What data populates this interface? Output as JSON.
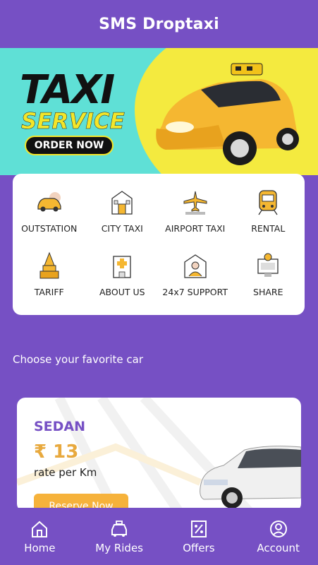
{
  "header": {
    "title": "SMS Droptaxi"
  },
  "banner": {
    "headline": "TAXI",
    "subheadline": "SERVICE",
    "cta_label": "ORDER NOW"
  },
  "services": [
    {
      "label": "OUTSTATION",
      "icon": "car-icon"
    },
    {
      "label": "CITY TAXI",
      "icon": "building-icon"
    },
    {
      "label": "AIRPORT TAXI",
      "icon": "airplane-icon"
    },
    {
      "label": "RENTAL",
      "icon": "train-icon"
    },
    {
      "label": "TARIFF",
      "icon": "temple-icon"
    },
    {
      "label": "ABOUT US",
      "icon": "hospital-icon"
    },
    {
      "label": "24x7 SUPPORT",
      "icon": "support-agent-icon"
    },
    {
      "label": "SHARE",
      "icon": "share-screen-icon"
    }
  ],
  "section": {
    "choose_title": "Choose your favorite car"
  },
  "car_card": {
    "category": "SEDAN",
    "price": "₹ 13",
    "price_unit": "rate per Km",
    "reserve_label": "Reserve Now"
  },
  "bottom_nav": [
    {
      "label": "Home",
      "icon": "home-icon"
    },
    {
      "label": "My Rides",
      "icon": "taxi-icon"
    },
    {
      "label": "Offers",
      "icon": "percent-tag-icon"
    },
    {
      "label": "Account",
      "icon": "user-icon"
    }
  ],
  "colors": {
    "primary": "#7650c4",
    "accent": "#f6b23b",
    "banner_teal": "#5fe0d6",
    "banner_yellow": "#f4ea3f"
  }
}
